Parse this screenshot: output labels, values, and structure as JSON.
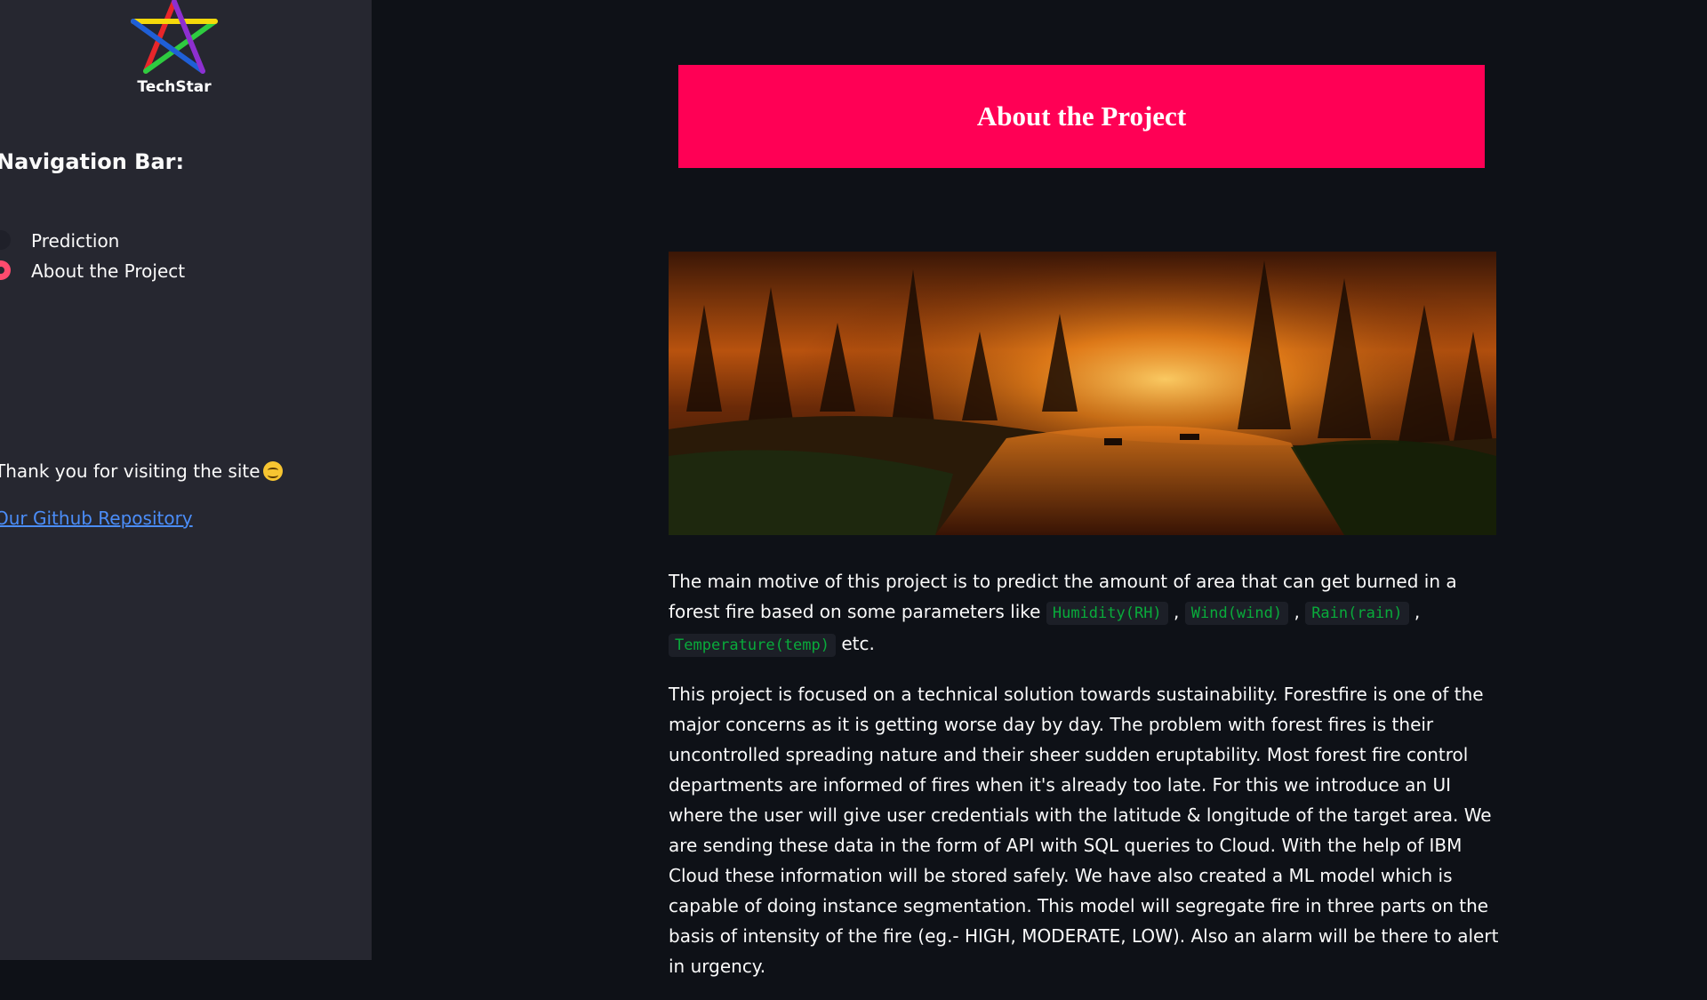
{
  "sidebar": {
    "logo_text": "TechStar",
    "nav_title": "Navigation Bar:",
    "radio_options": [
      {
        "label": "Prediction",
        "selected": false
      },
      {
        "label": "About the Project",
        "selected": true
      }
    ],
    "thanks_text": "Thank you for visiting the site",
    "github_link": "Our Github Repository"
  },
  "main": {
    "banner_title": "About the Project",
    "paragraph1": {
      "before": "The main motive of this project is to predict the amount of area that can get burned in a forest fire based on some parameters like ",
      "codes": [
        "Humidity(RH)",
        "Wind(wind)",
        "Rain(rain)",
        "Temperature(temp)"
      ],
      "after": " etc."
    },
    "paragraph2": "This project is focused on a technical solution towards sustainability. Forestfire is one of the major concerns as it is getting worse day by day. The problem with forest fires is their uncontrolled spreading nature and their sheer sudden eruptability. Most forest fire control departments are informed of fires when it's already too late. For this we introduce an UI where the user will give user credentials with the latitude & longitude of the target area. We are sending these data in the form of API with SQL queries to Cloud. With the help of IBM Cloud these information will be stored safely. We have also created a ML model which is capable of doing instance segmentation. This model will segregate fire in three parts on the basis of intensity of the fire (eg.- HIGH, MODERATE, LOW). Also an alarm will be there to alert in urgency."
  },
  "colors": {
    "app_background": "#0e1117",
    "sidebar_background": "#262730",
    "banner": "#ff0055",
    "radio_selected": "#ff4b6e",
    "code_text": "#09ab3b",
    "link": "#4b8df8"
  },
  "icons": {
    "logo": "rainbow-star-icon",
    "emoji": "smiling-face-emoji-icon"
  }
}
